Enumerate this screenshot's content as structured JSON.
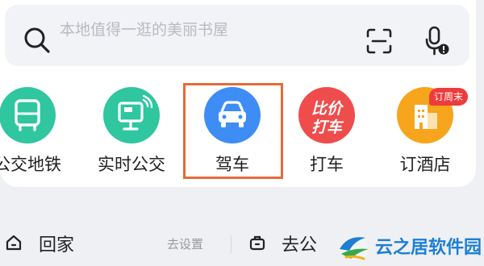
{
  "search": {
    "placeholder": "本地值得一逛的美丽书屋",
    "search_icon": "search-icon",
    "scan_icon": "scan-icon",
    "voice_icon": "microphone-icon"
  },
  "shortcuts": [
    {
      "label": "公交地铁",
      "icon": "bus-icon",
      "color": "#2fc6a0"
    },
    {
      "label": "实时公交",
      "icon": "bus-stop-screen-icon",
      "color": "#2fc6a0"
    },
    {
      "label": "驾车",
      "icon": "car-icon",
      "color": "#3d8df5",
      "highlighted": true
    },
    {
      "label": "打车",
      "icon": "taxi-promo-icon",
      "promo_text": "比价打车",
      "color": "#ef4c4c"
    },
    {
      "label": "订酒店",
      "icon": "hotel-icon",
      "badge": "订周末",
      "color": "#f7a51c"
    }
  ],
  "home": {
    "label": "回家",
    "setting": "去设置",
    "icon": "home-icon"
  },
  "work": {
    "label": "去公",
    "icon": "briefcase-icon"
  },
  "watermark": {
    "text": "云之居软件园"
  },
  "colors": {
    "highlight": "#e66a3b",
    "badge": "#ee3b3b",
    "watermark": "#1e7fd3"
  }
}
